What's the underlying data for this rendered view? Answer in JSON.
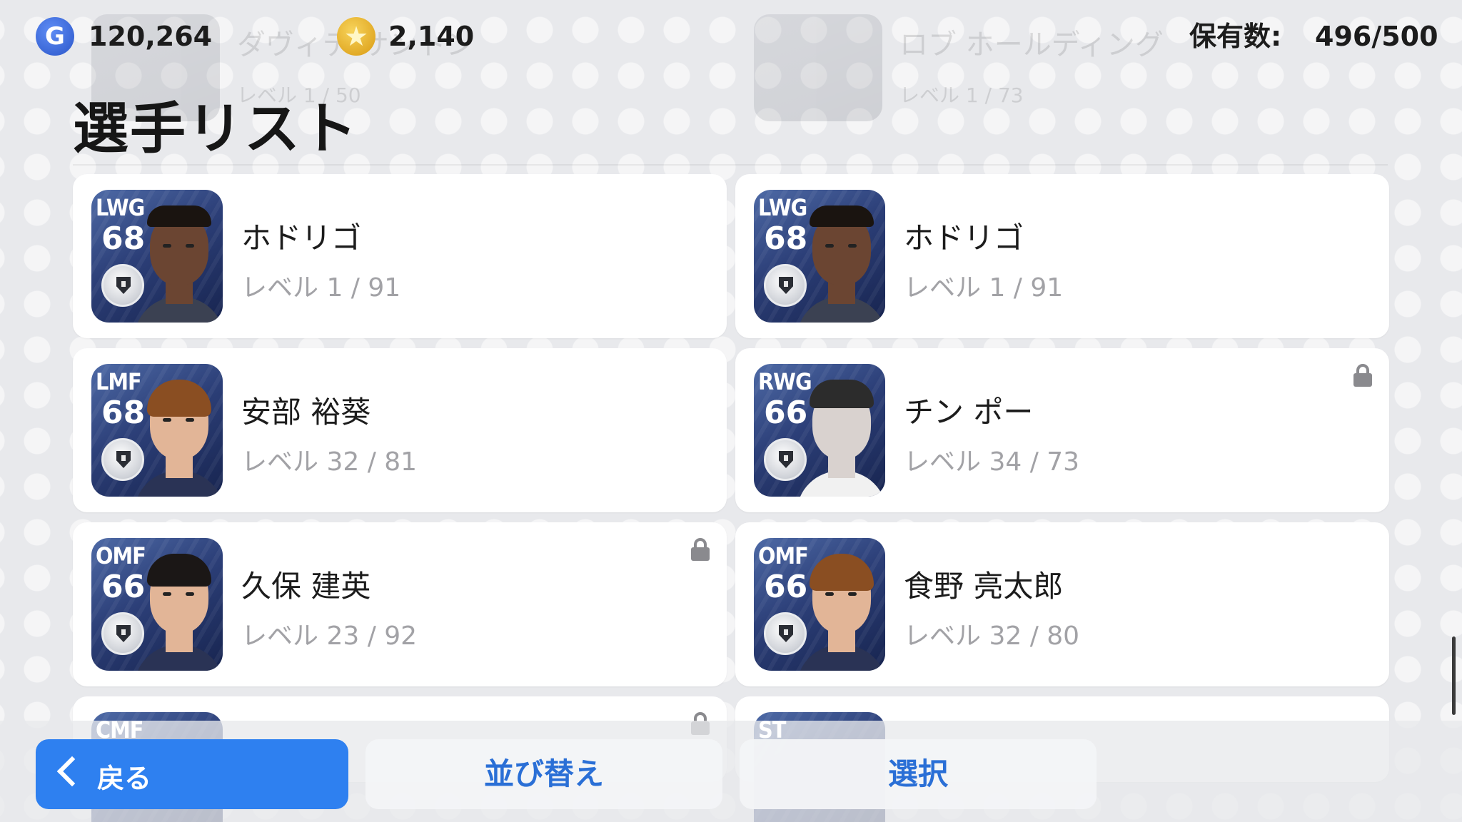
{
  "header": {
    "gp_amount": "120,264",
    "coin_amount": "2,140",
    "owned_label": "保有数:",
    "owned_value": "496/500",
    "g_icon_letter": "G",
    "star_glyph": "★"
  },
  "page_title": "選手リスト",
  "background_rows": [
    {
      "name": "ダヴィデ サントン",
      "level": "レベル 1 / 50"
    },
    {
      "name": "ロブ ホールディング",
      "level": "レベル 1 / 73"
    }
  ],
  "players": [
    {
      "position": "LWG",
      "rating": "68",
      "name": "ホドリゴ",
      "level": "レベル 1 / 91",
      "locked": false
    },
    {
      "position": "LWG",
      "rating": "68",
      "name": "ホドリゴ",
      "level": "レベル 1 / 91",
      "locked": false
    },
    {
      "position": "LMF",
      "rating": "68",
      "name": "安部 裕葵",
      "level": "レベル 32 / 81",
      "locked": false
    },
    {
      "position": "RWG",
      "rating": "66",
      "name": "チン ポー",
      "level": "レベル 34 / 73",
      "locked": true
    },
    {
      "position": "OMF",
      "rating": "66",
      "name": "久保 建英",
      "level": "レベル 23 / 92",
      "locked": true
    },
    {
      "position": "OMF",
      "rating": "66",
      "name": "食野 亮太郎",
      "level": "レベル 32 / 80",
      "locked": false
    },
    {
      "position": "CMF",
      "rating": "",
      "name": "",
      "level": "",
      "locked": true
    },
    {
      "position": "ST",
      "rating": "",
      "name": "",
      "level": "",
      "locked": false
    }
  ],
  "footer": {
    "back_label": "戻る",
    "sort_label": "並び替え",
    "select_label": "選択"
  },
  "colors": {
    "accent": "#2e80f0",
    "button_text": "#2a6fd6",
    "background": "#e8e9ec"
  }
}
